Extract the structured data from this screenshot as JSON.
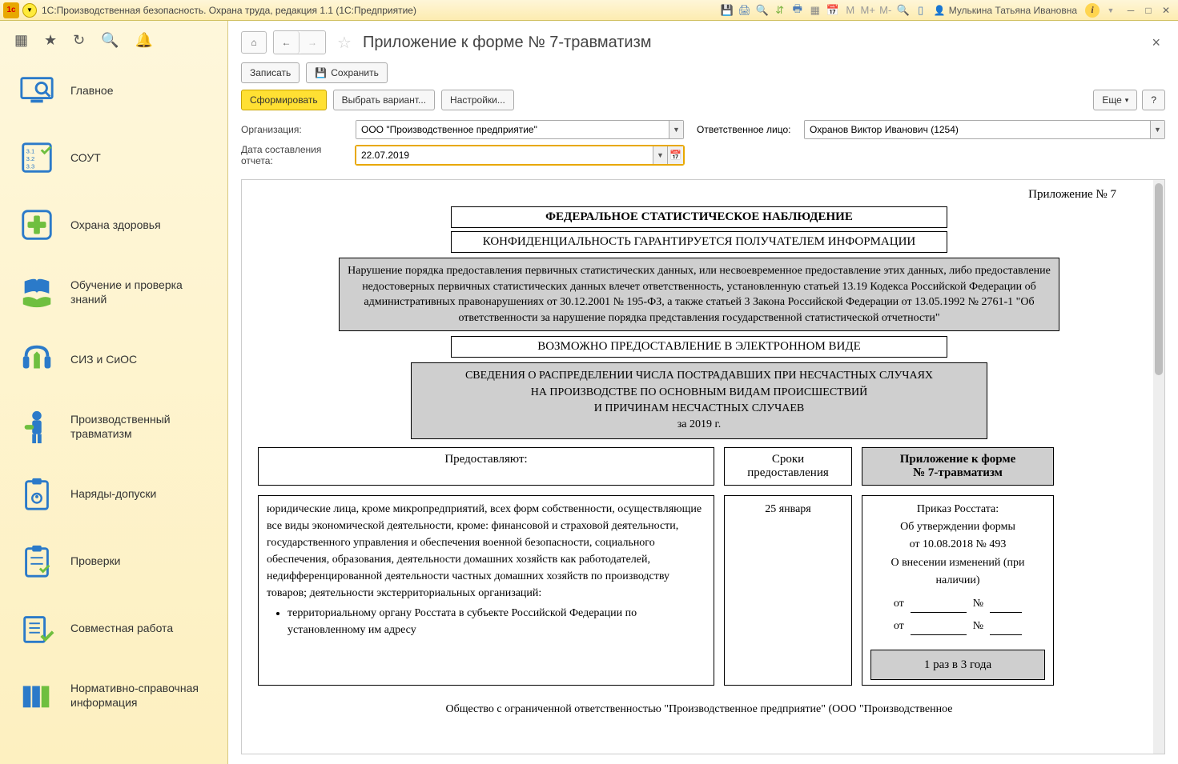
{
  "titlebar": {
    "app_title": "1С:Производственная безопасность. Охрана труда, редакция 1.1  (1С:Предприятие)",
    "user": "Мулькина Татьяна Ивановна",
    "m_labels": [
      "M",
      "M+",
      "M-"
    ]
  },
  "sidebar": {
    "items": [
      {
        "label": "Главное"
      },
      {
        "label": "СОУТ"
      },
      {
        "label": "Охрана здоровья"
      },
      {
        "label": "Обучение и проверка знаний"
      },
      {
        "label": "СИЗ и СиОС"
      },
      {
        "label": "Производственный травматизм"
      },
      {
        "label": "Наряды-допуски"
      },
      {
        "label": "Проверки"
      },
      {
        "label": "Совместная работа"
      },
      {
        "label": "Нормативно-справочная информация"
      }
    ]
  },
  "page": {
    "title": "Приложение к форме № 7-травматизм",
    "close": "×"
  },
  "toolbar1": {
    "record": "Записать",
    "save": "Сохранить"
  },
  "toolbar2": {
    "form": "Сформировать",
    "variant": "Выбрать вариант...",
    "settings": "Настройки...",
    "more": "Еще",
    "help": "?"
  },
  "filters": {
    "org_label": "Организация:",
    "org_value": "ООО \"Производственное предприятие\"",
    "resp_label": "Ответственное лицо:",
    "resp_value": "Охранов Виктор Иванович (1254)",
    "date_label": "Дата составления отчета:",
    "date_value": "22.07.2019"
  },
  "report": {
    "appendix": "Приложение № 7",
    "h1": "ФЕДЕРАЛЬНОЕ СТАТИСТИЧЕСКОЕ НАБЛЮДЕНИЕ",
    "h2": "КОНФИДЕНЦИАЛЬНОСТЬ ГАРАНТИРУЕТСЯ ПОЛУЧАТЕЛЕМ ИНФОРМАЦИИ",
    "warn": "Нарушение порядка предоставления первичных статистических данных, или несвоевременное предоставление этих данных, либо предоставление недостоверных первичных статистических данных влечет ответственность, установленную статьей 13.19 Кодекса Российской Федерации об административных правонарушениях от 30.12.2001 № 195-ФЗ, а также статьей 3 Закона Российской Федерации от 13.05.1992 № 2761-1 \"Об ответственности за нарушение порядка представления государственной статистической отчетности\"",
    "eform": "ВОЗМОЖНО ПРЕДОСТАВЛЕНИЕ В ЭЛЕКТРОННОМ ВИДЕ",
    "info": "СВЕДЕНИЯ О РАСПРЕДЕЛЕНИИ ЧИСЛА ПОСТРАДАВШИХ ПРИ НЕСЧАСТНЫХ СЛУЧАЯХ\nНА ПРОИЗВОДСТВЕ ПО ОСНОВНЫМ ВИДАМ ПРОИСШЕСТВИЙ\nИ ПРИЧИНАМ НЕСЧАСТНЫХ СЛУЧАЕВ\nза 2019 г.",
    "col1_h": "Предоставляют:",
    "col2_h": "Сроки предоставления",
    "col3_h": "Приложение к форме\n№ 7-травматизм",
    "col1_b": "юридические лица, кроме микропредприятий, всех форм собственности, осуществляющие все виды экономической деятельности, кроме: финансовой и страховой деятельности, государственного управления и обеспечения военной безопасности, социального обеспечения, образования, деятельности домашних хозяйств как работодателей, недифференцированной деятельности частных домашних хозяйств по производству товаров; деятельности экстерриториальных организаций:",
    "col1_li1": "территориальному органу Росстата в субъекте Российской Федерации по установленному им адресу",
    "col2_b": "25 января",
    "col3_l1": "Приказ Росстата:",
    "col3_l2": "Об утверждении формы",
    "col3_l3": "от 10.08.2018 № 493",
    "col3_l4": "О внесении изменений (при наличии)",
    "ot": "от",
    "num": "№",
    "freq": "1 раз в 3 года",
    "org_bottom": "Общество с ограниченной ответственностью \"Производственное предприятие\" (ООО \"Производственное"
  }
}
